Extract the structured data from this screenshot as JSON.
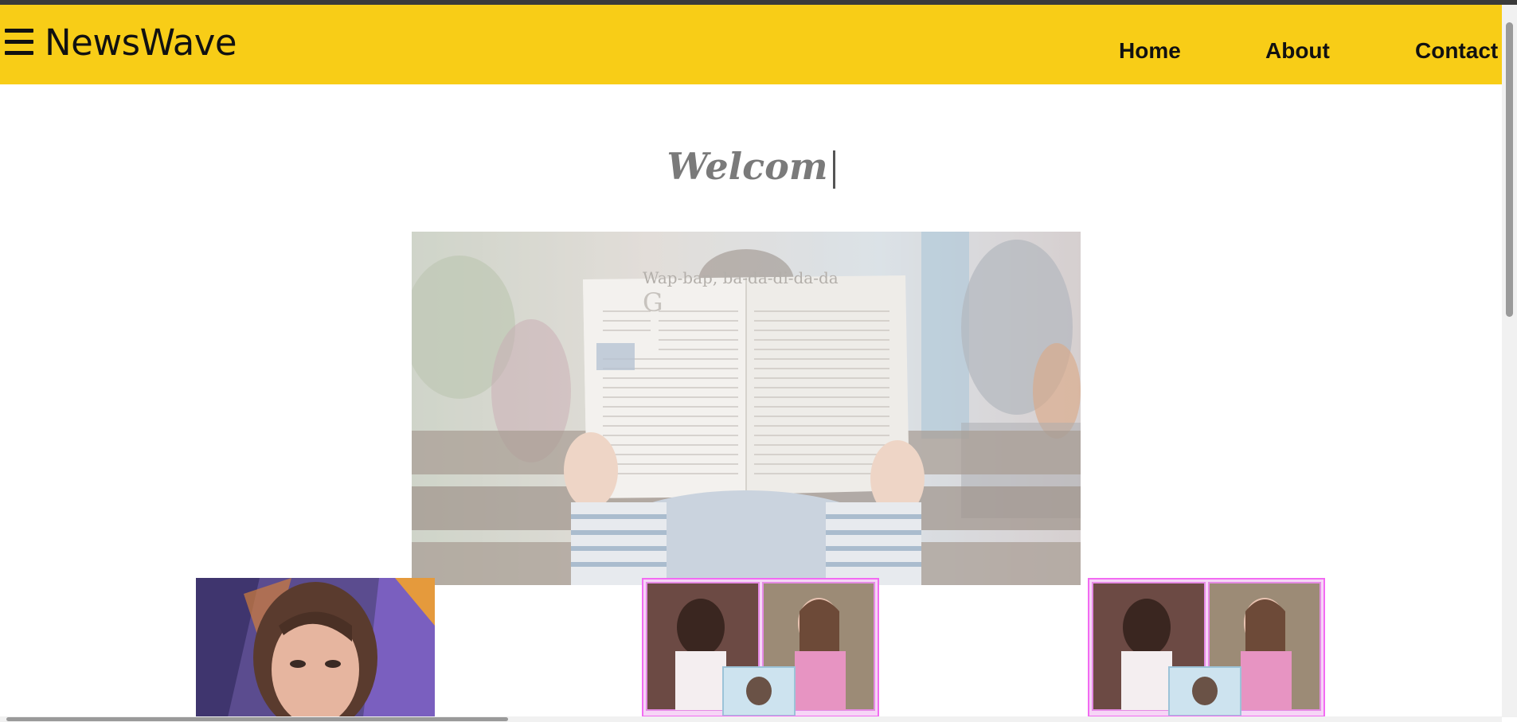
{
  "header": {
    "brand": "NewsWave",
    "menu_icon": "hamburger-menu-icon",
    "nav": [
      {
        "label": "Home"
      },
      {
        "label": "About"
      },
      {
        "label": "Contact"
      }
    ],
    "background": "#f8cd17"
  },
  "main": {
    "welcome_text": "Welcom",
    "hero_image_text": "Wap-bap, ba-da-di-da-da"
  },
  "colors": {
    "accent": "#f8cd17",
    "card_border": "#f26bf2"
  }
}
